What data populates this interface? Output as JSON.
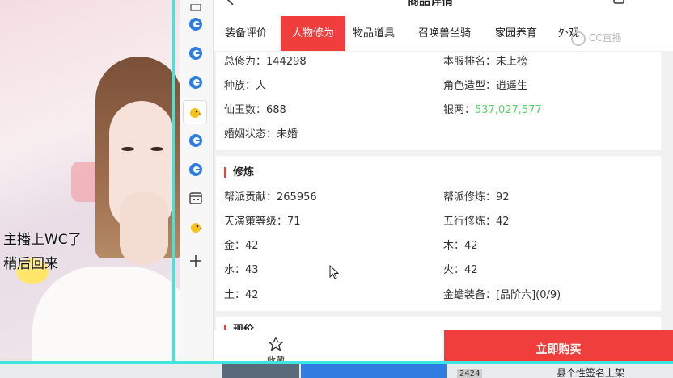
{
  "overlay": {
    "line1": "主播上WC了",
    "line2": "稍后回来"
  },
  "header": {
    "title": "商品详情"
  },
  "tabs": [
    {
      "label": "装备评价",
      "active": false
    },
    {
      "label": "人物修为",
      "active": true
    },
    {
      "label": "物品道具",
      "active": false
    },
    {
      "label": "召唤兽坐骑",
      "active": false
    },
    {
      "label": "家园养育",
      "active": false
    },
    {
      "label": "外观",
      "active": false
    }
  ],
  "watermark": "CC直播",
  "info_card": {
    "rows": [
      {
        "left_label": "总修为：",
        "left_value": "144298",
        "right_label": "本服排名：",
        "right_value": "未上榜"
      },
      {
        "left_label": "种族：",
        "left_value": "人",
        "right_label": "角色造型：",
        "right_value": "逍遥生"
      },
      {
        "left_label": "仙玉数：",
        "left_value": "688",
        "right_label": "银两：",
        "right_value": "537,027,577"
      },
      {
        "left_label": "婚姻状态：",
        "left_value": "未婚",
        "right_label": "",
        "right_value": ""
      }
    ]
  },
  "xiulian_card": {
    "title": "修炼",
    "rows": [
      {
        "left_label": "帮派贡献：",
        "left_value": "265956",
        "right_label": "帮派修炼：",
        "right_value": "92"
      },
      {
        "left_label": "天演策等级：",
        "left_value": "71",
        "right_label": "五行修炼：",
        "right_value": "42"
      },
      {
        "left_label": "金：",
        "left_value": "42",
        "right_label": "木：",
        "right_value": "42"
      },
      {
        "left_label": "水：",
        "left_value": "43",
        "right_label": "火：",
        "right_value": "42"
      },
      {
        "left_label": "土：",
        "left_value": "42",
        "right_label": "金蟾装备：",
        "right_value": "[品阶六](0/9)"
      }
    ]
  },
  "next_card": {
    "title": "现价"
  },
  "bottom_bar": {
    "favorite_label": "收藏",
    "buy_label": "立即购买"
  },
  "taskbar": {
    "text1": "2424",
    "text2": "县个性签名上架"
  },
  "colors": {
    "accent": "#ef3e3c",
    "silver_value": "#5fcf6a",
    "overlay_border": "#3fe6e0"
  }
}
